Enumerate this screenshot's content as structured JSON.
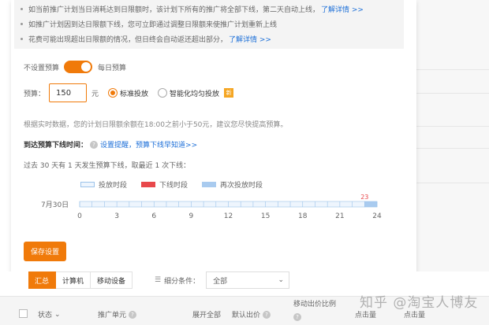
{
  "tips": [
    {
      "text": "如当前推广计划当日消耗达到日限额时，该计划下所有的推广将全部下线，第二天自动上线，",
      "link": "了解详情 >>"
    },
    {
      "text": "如推广计划因到达日限额下线，您可立即通过调整日限额来使推广计划重新上线",
      "link": ""
    },
    {
      "text": "花费可能出现超出日限额的情况，但日终会自动返还超出部分，",
      "link": "了解详情 >>"
    }
  ],
  "budget_toggle": {
    "left_label": "不设置预算",
    "right_label": "每日预算",
    "on": true
  },
  "budget": {
    "label": "预算：",
    "value": "150",
    "unit": "元"
  },
  "delivery": {
    "standard": "标准投放",
    "smart": "智能化均匀投放",
    "new_badge": "新",
    "selected": "standard"
  },
  "estimate_note": "根据实时数据，您的计划日限额余额在18:00之前小于50元，建议您尽快提高预算。",
  "offline": {
    "label": "到达预算下线时间：",
    "link1": "设置提醒",
    "link2": "，预算下线早知道>>"
  },
  "history_note": "过去 30 天有 1 天发生预算下线，取最近 1 次下线：",
  "legend": [
    {
      "name": "投放时段",
      "color": "#eef5fd"
    },
    {
      "name": "下线时段",
      "color": "#e8484b"
    },
    {
      "name": "再次投放时段",
      "color": "#a9cbef"
    }
  ],
  "chart_data": {
    "type": "timeline",
    "date_label": "7月30日",
    "x_ticks": [
      0,
      3,
      6,
      9,
      12,
      15,
      18,
      21,
      24
    ],
    "xlim": [
      0,
      24
    ],
    "segments": [
      {
        "type": "投放时段",
        "start": 0,
        "end": 23
      },
      {
        "type": "再次投放时段",
        "start": 23,
        "end": 24
      }
    ],
    "offline_marker": {
      "hour": 23,
      "label": "23"
    }
  },
  "save_button": "保存设置",
  "tabs": [
    "汇总",
    "计算机",
    "移动设备"
  ],
  "filter": {
    "label": "细分条件：",
    "value": "全部"
  },
  "table_headers": {
    "status": "状态",
    "unit": "推广单元",
    "expand": "展开全部",
    "default_bid": "默认出价",
    "mobile_ratio": "移动出价比例",
    "impressions": "点击量",
    "clicks": "点击量"
  },
  "watermark": "知乎 @淘宝人博友"
}
